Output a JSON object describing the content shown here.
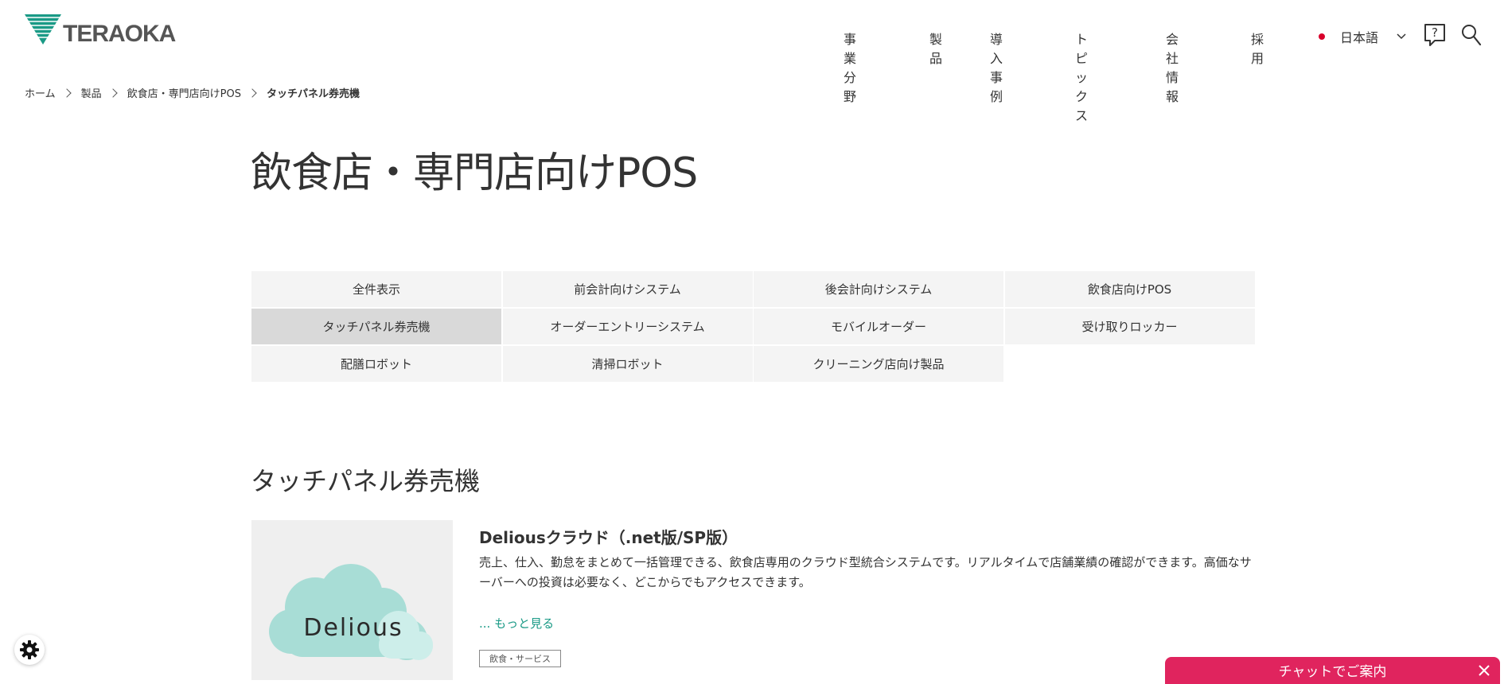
{
  "header": {
    "logo_text": "TERAOKA",
    "nav": [
      "事業分野",
      "製品",
      "導入事例",
      "トピックス",
      "会社情報",
      "採用"
    ],
    "language": "日本語",
    "icons": [
      "help-icon",
      "search-icon",
      "chevron-down-icon",
      "japan-flag-icon"
    ]
  },
  "breadcrumb": [
    "ホーム",
    "製品",
    "飲食店・専門店向けPOS",
    "タッチパネル券売機"
  ],
  "page_title": "飲食店・専門店向けPOS",
  "categories": [
    {
      "label": "全件表示",
      "active": false
    },
    {
      "label": "前会計向けシステム",
      "active": false
    },
    {
      "label": "後会計向けシステム",
      "active": false
    },
    {
      "label": "飲食店向けPOS",
      "active": false
    },
    {
      "label": "タッチパネル券売機",
      "active": true
    },
    {
      "label": "オーダーエントリーシステム",
      "active": false
    },
    {
      "label": "モバイルオーダー",
      "active": false
    },
    {
      "label": "受け取りロッカー",
      "active": false
    },
    {
      "label": "配膳ロボット",
      "active": false
    },
    {
      "label": "清掃ロボット",
      "active": false
    },
    {
      "label": "クリーニング店向け製品",
      "active": false
    }
  ],
  "section_title": "タッチパネル券売機",
  "product": {
    "name": "Deliousクラウド（.net版/SP版）",
    "image_text": "Delious",
    "description": "売上、仕入、勤怠をまとめて一括管理できる、飲食店専用のクラウド型統合システムです。リアルタイムで店舗業績の確認ができます。高価なサーバーへの投資は必要なく、どこからでもアクセスできます。",
    "more_link": "... もっと見る",
    "tag": "飲食・サービス"
  },
  "chat": {
    "label": "チャットでご案内"
  },
  "colors": {
    "accent_green": "#1a9a86",
    "chat_pink": "#e0245e",
    "active_tab": "#d9d9d9",
    "tab_bg": "#f4f4f4",
    "cloud": "#a8ddd6"
  }
}
